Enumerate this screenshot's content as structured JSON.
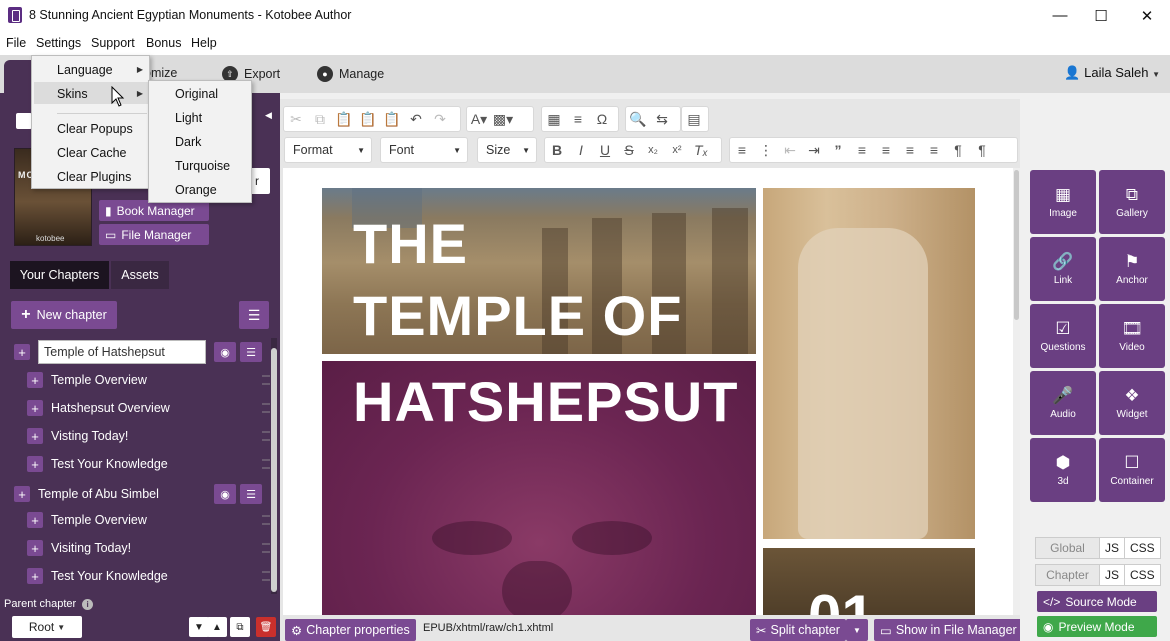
{
  "window": {
    "title": "8 Stunning Ancient Egyptian Monuments - Kotobee Author"
  },
  "menubar": {
    "file": "File",
    "settings": "Settings",
    "support": "Support",
    "bonus": "Bonus",
    "help": "Help"
  },
  "header": {
    "tab_customize_partial": "omize",
    "tab_export": "Export",
    "tab_manage": "Manage",
    "user_name": "Laila Saleh"
  },
  "settings_menu": {
    "language": "Language",
    "skins": "Skins",
    "clear_popups": "Clear Popups",
    "clear_cache": "Clear Cache",
    "clear_plugins": "Clear Plugins"
  },
  "skins_menu": {
    "items": [
      "Original",
      "Light",
      "Dark",
      "Turquoise",
      "Orange"
    ]
  },
  "book": {
    "cover_title_partial": "MO",
    "cover_brand": "kotobee",
    "partial_button": "r",
    "book_manager": "Book Manager",
    "file_manager": "File Manager"
  },
  "sidebar": {
    "tab_chapters": "Your Chapters",
    "tab_assets": "Assets",
    "new_chapter": "New chapter",
    "chapters": [
      {
        "title": "Temple of Hatshepsut",
        "sections": [
          "Temple Overview",
          "Hatshepsut Overview",
          "Visting Today!",
          "Test Your Knowledge"
        ]
      },
      {
        "title": "Temple of Abu Simbel",
        "sections": [
          "Temple Overview",
          "Visiting Today!",
          "Test Your Knowledge"
        ]
      }
    ],
    "parent_chapter_label": "Parent chapter",
    "root_select": "Root"
  },
  "editor": {
    "format_select": "Format",
    "font_select": "Font",
    "size_select": "Size",
    "page": {
      "title_line1": "THE",
      "title_line2": "TEMPLE OF",
      "title_line3": "HATSHEPSUT",
      "chapter_number_partial": "01"
    },
    "status": {
      "chapter_properties": "Chapter properties",
      "path": "EPUB/xhtml/raw/ch1.xhtml",
      "split_chapter": "Split chapter",
      "show_in_file_manager": "Show in File Manager"
    }
  },
  "widgets": [
    {
      "label": "Image",
      "icon": "image-icon"
    },
    {
      "label": "Gallery",
      "icon": "gallery-icon"
    },
    {
      "label": "Link",
      "icon": "link-icon"
    },
    {
      "label": "Anchor",
      "icon": "anchor-flag-icon"
    },
    {
      "label": "Questions",
      "icon": "questions-check-icon"
    },
    {
      "label": "Video",
      "icon": "video-film-icon"
    },
    {
      "label": "Audio",
      "icon": "microphone-icon"
    },
    {
      "label": "Widget",
      "icon": "puzzle-icon"
    },
    {
      "label": "3d",
      "icon": "cube-icon"
    },
    {
      "label": "Container",
      "icon": "square-icon"
    }
  ],
  "right_panel": {
    "global_label": "Global",
    "chapter_label": "Chapter",
    "js": "JS",
    "css": "CSS",
    "source_mode": "Source Mode",
    "preview_mode": "Preview Mode"
  },
  "colors": {
    "sidebar_bg": "#4a3155",
    "accent_purple": "#7a4a92",
    "widget_purple": "#6a3f82",
    "preview_green": "#3fa84a",
    "delete_red": "#c9302c"
  }
}
